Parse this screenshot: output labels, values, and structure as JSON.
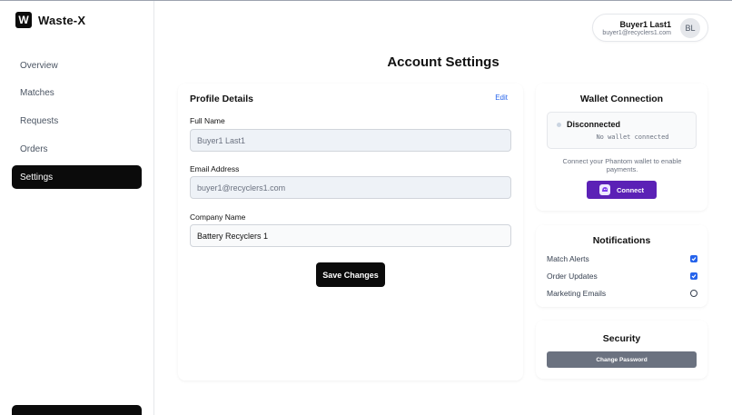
{
  "brand": {
    "logo_letter": "W",
    "name": "Waste-X"
  },
  "sidebar": {
    "items": [
      {
        "label": "Overview",
        "active": false
      },
      {
        "label": "Matches",
        "active": false
      },
      {
        "label": "Requests",
        "active": false
      },
      {
        "label": "Orders",
        "active": false
      },
      {
        "label": "Settings",
        "active": true
      }
    ]
  },
  "user": {
    "name": "Buyer1 Last1",
    "email": "buyer1@recyclers1.com",
    "initials": "BL"
  },
  "page": {
    "title": "Account Settings"
  },
  "profile": {
    "title": "Profile Details",
    "edit_label": "Edit",
    "full_name_label": "Full Name",
    "full_name_value": "Buyer1 Last1",
    "email_label": "Email Address",
    "email_value": "buyer1@recyclers1.com",
    "company_label": "Company Name",
    "company_value": "Battery Recyclers 1",
    "save_label": "Save Changes"
  },
  "wallet": {
    "title": "Wallet Connection",
    "status": "Disconnected",
    "detail": "No wallet connected",
    "help": "Connect your Phantom wallet to enable payments.",
    "connect_label": "Connect"
  },
  "notifications": {
    "title": "Notifications",
    "items": [
      {
        "label": "Match Alerts",
        "checked": true
      },
      {
        "label": "Order Updates",
        "checked": true
      },
      {
        "label": "Marketing Emails",
        "checked": false
      }
    ]
  },
  "security": {
    "title": "Security",
    "change_password_label": "Change Password"
  },
  "colors": {
    "accent": "#0b0b0b",
    "link": "#2563eb",
    "wallet_button": "#5b21b6",
    "checkbox_on": "#2563eb"
  },
  "icons": {
    "phantom": "phantom-wallet-icon",
    "check": "check-icon"
  }
}
